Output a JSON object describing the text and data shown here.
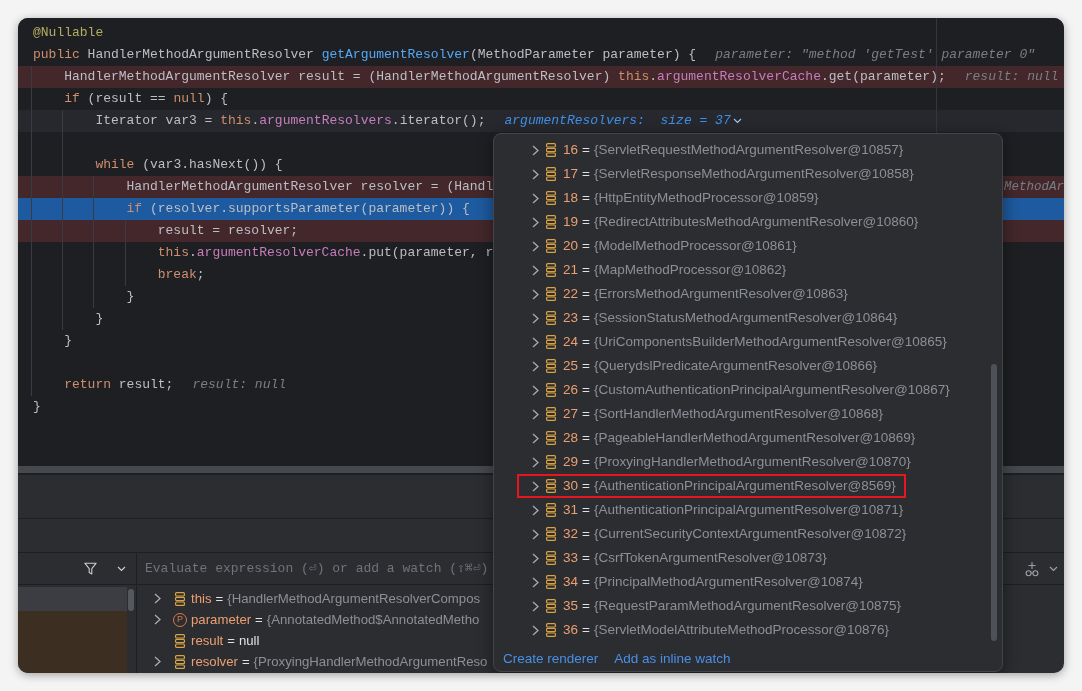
{
  "editor": {
    "lines": [
      {
        "kind": "plain",
        "code": [
          {
            "kind": "annotation",
            "text": "@Nullable"
          }
        ]
      },
      {
        "kind": "plain",
        "code": [
          {
            "kind": "keyword",
            "text": "public"
          },
          {
            "kind": "plain",
            "text": " HandlerMethodArgumentResolver "
          },
          {
            "kind": "method",
            "text": "getArgumentResolver"
          },
          {
            "kind": "plain",
            "text": "(MethodParameter parameter) {"
          }
        ],
        "hint": {
          "kind": "value",
          "text": "parameter: \"method 'getTest' parameter 0\""
        },
        "children": [
          {
            "kind": "breakpoint",
            "code": [
              {
                "kind": "plain",
                "text": "HandlerMethodArgumentResolver result = (HandlerMethodArgumentResolver) "
              },
              {
                "kind": "keyword",
                "text": "this"
              },
              {
                "kind": "plain",
                "text": "."
              },
              {
                "kind": "field",
                "text": "argumentResolverCache"
              },
              {
                "kind": "plain",
                "text": ".get(parameter);"
              }
            ],
            "hint": {
              "kind": "value",
              "text": "result: null"
            }
          },
          {
            "kind": "plain",
            "code": [
              {
                "kind": "keyword",
                "text": "if"
              },
              {
                "kind": "plain",
                "text": " (result == "
              },
              {
                "kind": "keyword",
                "text": "null"
              },
              {
                "kind": "plain",
                "text": ") {"
              }
            ],
            "children": [
              {
                "kind": "caret",
                "code": [
                  {
                    "kind": "plain",
                    "text": "Iterator var3 = "
                  },
                  {
                    "kind": "keyword",
                    "text": "this"
                  },
                  {
                    "kind": "plain",
                    "text": "."
                  },
                  {
                    "kind": "field",
                    "text": "argumentResolvers"
                  },
                  {
                    "kind": "plain",
                    "text": ".iterator();"
                  }
                ],
                "hint": {
                  "kind": "collection",
                  "text": "argumentResolvers:  size = 37"
                }
              },
              {
                "kind": "blank"
              },
              {
                "kind": "plain",
                "code": [
                  {
                    "kind": "keyword",
                    "text": "while"
                  },
                  {
                    "kind": "plain",
                    "text": " (var3.hasNext()) {"
                  }
                ],
                "children": [
                  {
                    "kind": "breakpoint",
                    "code": [
                      {
                        "kind": "plain",
                        "text": "HandlerMethodArgumentResolver resolver = (Handl"
                      }
                    ],
                    "trailing_hint": "MethodAr"
                  },
                  {
                    "kind": "execution",
                    "code": [
                      {
                        "kind": "keyword",
                        "text": "if"
                      },
                      {
                        "kind": "plain",
                        "text": " (resolver.supportsParameter(parameter)) {"
                      }
                    ],
                    "children": [
                      {
                        "kind": "breakpoint",
                        "code": [
                          {
                            "kind": "plain",
                            "text": "result = resolver;"
                          }
                        ]
                      },
                      {
                        "kind": "plain",
                        "code": [
                          {
                            "kind": "keyword",
                            "text": "this"
                          },
                          {
                            "kind": "plain",
                            "text": "."
                          },
                          {
                            "kind": "field",
                            "text": "argumentResolverCache"
                          },
                          {
                            "kind": "plain",
                            "text": ".put(parameter, r"
                          }
                        ]
                      },
                      {
                        "kind": "plain",
                        "code": [
                          {
                            "kind": "keyword",
                            "text": "break"
                          },
                          {
                            "kind": "plain",
                            "text": ";"
                          }
                        ]
                      }
                    ]
                  },
                  {
                    "kind": "plain",
                    "code": [
                      {
                        "kind": "plain",
                        "text": "}"
                      }
                    ]
                  }
                ]
              },
              {
                "kind": "plain",
                "code": [
                  {
                    "kind": "plain",
                    "text": "}"
                  }
                ]
              }
            ]
          },
          {
            "kind": "plain",
            "code": [
              {
                "kind": "plain",
                "text": "}"
              }
            ]
          },
          {
            "kind": "blank"
          },
          {
            "kind": "plain",
            "code": [
              {
                "kind": "keyword",
                "text": "return"
              },
              {
                "kind": "plain",
                "text": " result;"
              }
            ],
            "hint": {
              "kind": "value",
              "text": "result: null"
            }
          }
        ]
      },
      {
        "kind": "plain",
        "code": [
          {
            "kind": "plain",
            "text": "}"
          }
        ]
      }
    ]
  },
  "debugger": {
    "evaluate": {
      "placeholder": "Evaluate expression (⏎) or add a watch (⇧⌘⏎)"
    },
    "frames": [
      {
        "selected": true,
        "library": false
      },
      {
        "selected": false,
        "library": true
      }
    ],
    "variables": [
      {
        "kind": "field",
        "name": "this",
        "sep": "=",
        "value": "{HandlerMethodArgumentResolverCompos",
        "expandable": true
      },
      {
        "kind": "parameter",
        "badge": "P",
        "name": "parameter",
        "sep": "=",
        "value": "{AnnotatedMethod$AnnotatedMetho",
        "expandable": true
      },
      {
        "kind": "field",
        "name": "result",
        "sep": "=",
        "value": "null",
        "expandable": false
      },
      {
        "kind": "field",
        "name": "resolver",
        "sep": "=",
        "value": "{ProxyingHandlerMethodArgumentReso",
        "expandable": true
      }
    ]
  },
  "popup": {
    "items": [
      {
        "index": "16",
        "sep": "=",
        "value": "{ServletRequestMethodArgumentResolver@10857}",
        "marked": false
      },
      {
        "index": "17",
        "sep": "=",
        "value": "{ServletResponseMethodArgumentResolver@10858}",
        "marked": false
      },
      {
        "index": "18",
        "sep": "=",
        "value": "{HttpEntityMethodProcessor@10859}",
        "marked": false
      },
      {
        "index": "19",
        "sep": "=",
        "value": "{RedirectAttributesMethodArgumentResolver@10860}",
        "marked": false
      },
      {
        "index": "20",
        "sep": "=",
        "value": "{ModelMethodProcessor@10861}",
        "marked": false
      },
      {
        "index": "21",
        "sep": "=",
        "value": "{MapMethodProcessor@10862}",
        "marked": false
      },
      {
        "index": "22",
        "sep": "=",
        "value": "{ErrorsMethodArgumentResolver@10863}",
        "marked": false
      },
      {
        "index": "23",
        "sep": "=",
        "value": "{SessionStatusMethodArgumentResolver@10864}",
        "marked": false
      },
      {
        "index": "24",
        "sep": "=",
        "value": "{UriComponentsBuilderMethodArgumentResolver@10865}",
        "marked": false
      },
      {
        "index": "25",
        "sep": "=",
        "value": "{QuerydslPredicateArgumentResolver@10866}",
        "marked": false
      },
      {
        "index": "26",
        "sep": "=",
        "value": "{CustomAuthenticationPrincipalArgumentResolver@10867}",
        "marked": false
      },
      {
        "index": "27",
        "sep": "=",
        "value": "{SortHandlerMethodArgumentResolver@10868}",
        "marked": false
      },
      {
        "index": "28",
        "sep": "=",
        "value": "{PageableHandlerMethodArgumentResolver@10869}",
        "marked": false
      },
      {
        "index": "29",
        "sep": "=",
        "value": "{ProxyingHandlerMethodArgumentResolver@10870}",
        "marked": false
      },
      {
        "index": "30",
        "sep": "=",
        "value": "{AuthenticationPrincipalArgumentResolver@8569}",
        "marked": true
      },
      {
        "index": "31",
        "sep": "=",
        "value": "{AuthenticationPrincipalArgumentResolver@10871}",
        "marked": false
      },
      {
        "index": "32",
        "sep": "=",
        "value": "{CurrentSecurityContextArgumentResolver@10872}",
        "marked": false
      },
      {
        "index": "33",
        "sep": "=",
        "value": "{CsrfTokenArgumentResolver@10873}",
        "marked": false
      },
      {
        "index": "34",
        "sep": "=",
        "value": "{PrincipalMethodArgumentResolver@10874}",
        "marked": false
      },
      {
        "index": "35",
        "sep": "=",
        "value": "{RequestParamMethodArgumentResolver@10875}",
        "marked": false
      },
      {
        "index": "36",
        "sep": "=",
        "value": "{ServletModelAttributeMethodProcessor@10876}",
        "marked": false
      }
    ],
    "links": [
      "Create renderer",
      "Add as inline watch"
    ]
  }
}
